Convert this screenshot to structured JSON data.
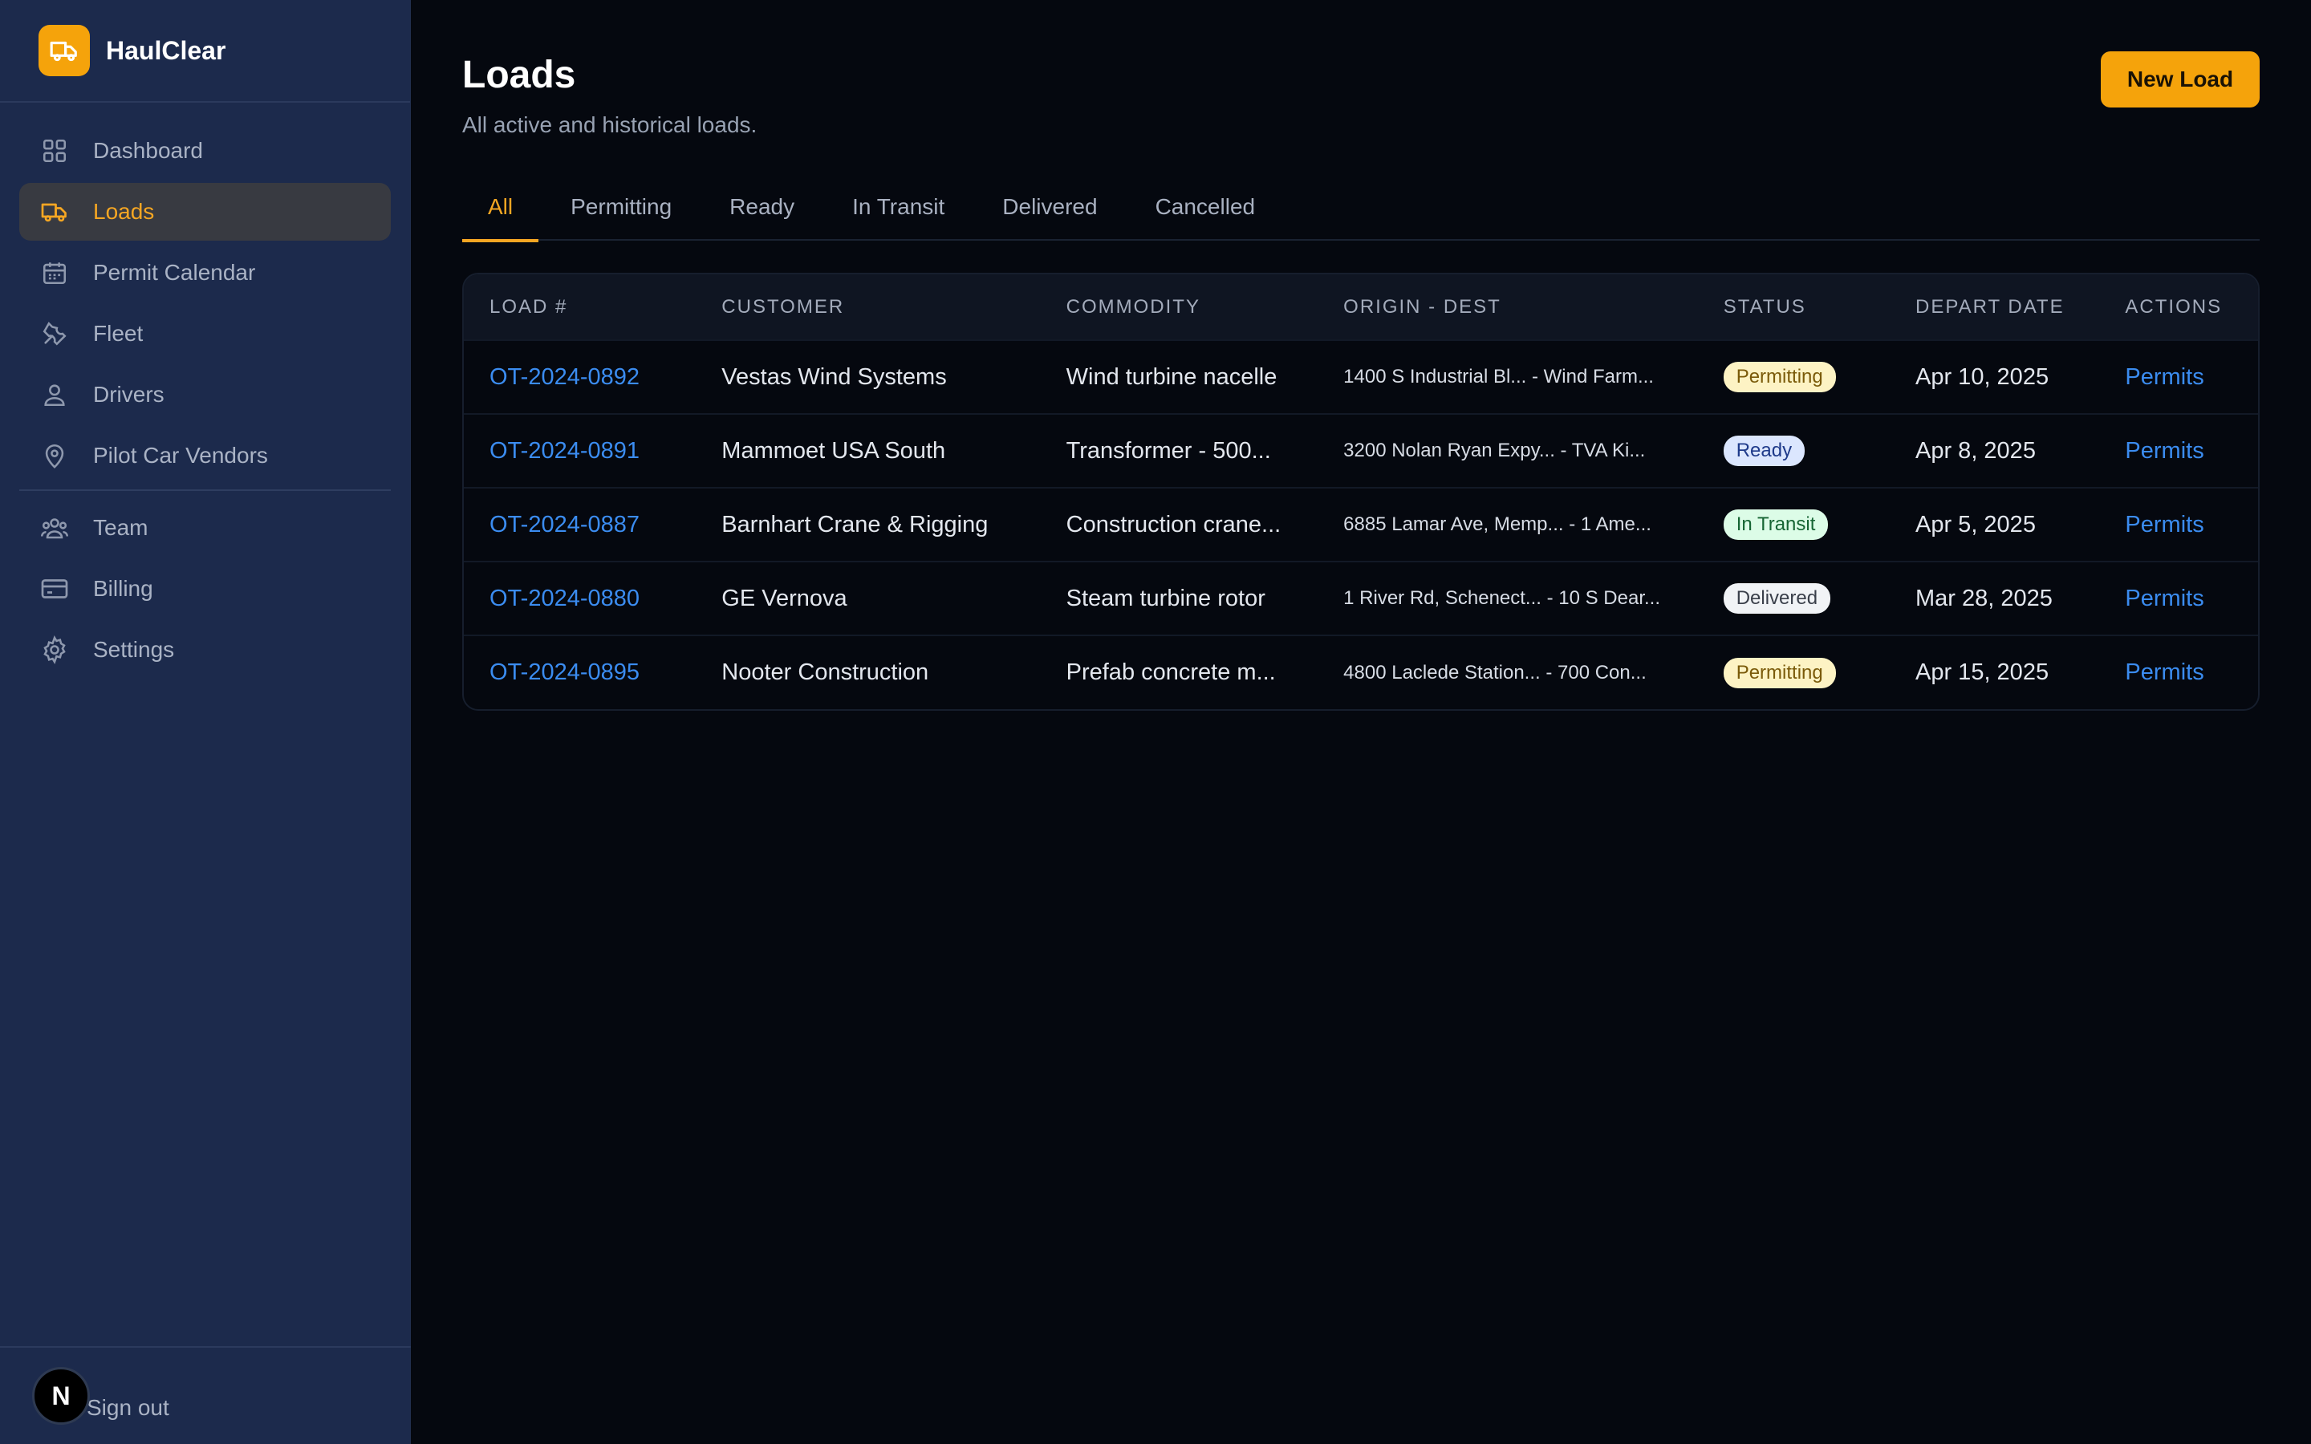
{
  "brand": {
    "name": "HaulClear",
    "accent": "#f5a30b",
    "logo_icon": "truck-icon"
  },
  "sidebar": {
    "items": [
      {
        "key": "dashboard",
        "label": "Dashboard",
        "icon": "grid-icon",
        "active": false
      },
      {
        "key": "loads",
        "label": "Loads",
        "icon": "truck-icon",
        "active": true
      },
      {
        "key": "permit-calendar",
        "label": "Permit Calendar",
        "icon": "calendar-icon",
        "active": false
      },
      {
        "key": "fleet",
        "label": "Fleet",
        "icon": "wrench-icon",
        "active": false
      },
      {
        "key": "drivers",
        "label": "Drivers",
        "icon": "user-icon",
        "active": false
      },
      {
        "key": "pilot-car-vendors",
        "label": "Pilot Car Vendors",
        "icon": "map-pin-icon",
        "active": false
      },
      {
        "key": "team",
        "label": "Team",
        "icon": "users-icon",
        "active": false
      },
      {
        "key": "billing",
        "label": "Billing",
        "icon": "credit-card-icon",
        "active": false
      },
      {
        "key": "settings",
        "label": "Settings",
        "icon": "gear-icon",
        "active": false
      }
    ],
    "footer": {
      "avatar_initial": "N",
      "signout_label": "Sign out"
    }
  },
  "header": {
    "title": "Loads",
    "subtitle": "All active and historical loads.",
    "new_load_label": "New Load"
  },
  "tabs": [
    {
      "label": "All",
      "active": true
    },
    {
      "label": "Permitting",
      "active": false
    },
    {
      "label": "Ready",
      "active": false
    },
    {
      "label": "In Transit",
      "active": false
    },
    {
      "label": "Delivered",
      "active": false
    },
    {
      "label": "Cancelled",
      "active": false
    }
  ],
  "table": {
    "columns": [
      "LOAD #",
      "CUSTOMER",
      "COMMODITY",
      "ORIGIN - DEST",
      "STATUS",
      "DEPART DATE",
      "ACTIONS"
    ],
    "rows": [
      {
        "load": "OT-2024-0892",
        "customer": "Vestas Wind Systems",
        "commodity": "Wind turbine nacelle",
        "route": "1400 S Industrial Bl... - Wind Farm...",
        "status": "Permitting",
        "status_class": "permitting",
        "depart": "Apr 10, 2025",
        "action": "Permits"
      },
      {
        "load": "OT-2024-0891",
        "customer": "Mammoet USA South",
        "commodity": "Transformer - 500...",
        "route": "3200 Nolan Ryan Expy... - TVA Ki...",
        "status": "Ready",
        "status_class": "ready",
        "depart": "Apr 8, 2025",
        "action": "Permits"
      },
      {
        "load": "OT-2024-0887",
        "customer": "Barnhart Crane & Rigging",
        "commodity": "Construction crane...",
        "route": "6885 Lamar Ave, Memp... - 1 Ame...",
        "status": "In Transit",
        "status_class": "transit",
        "depart": "Apr 5, 2025",
        "action": "Permits"
      },
      {
        "load": "OT-2024-0880",
        "customer": "GE Vernova",
        "commodity": "Steam turbine rotor",
        "route": "1 River Rd, Schenect... - 10 S Dear...",
        "status": "Delivered",
        "status_class": "delivered",
        "depart": "Mar 28, 2025",
        "action": "Permits"
      },
      {
        "load": "OT-2024-0895",
        "customer": "Nooter Construction",
        "commodity": "Prefab concrete m...",
        "route": "4800 Laclede Station... - 700 Con...",
        "status": "Permitting",
        "status_class": "permitting",
        "depart": "Apr 15, 2025",
        "action": "Permits"
      }
    ]
  }
}
